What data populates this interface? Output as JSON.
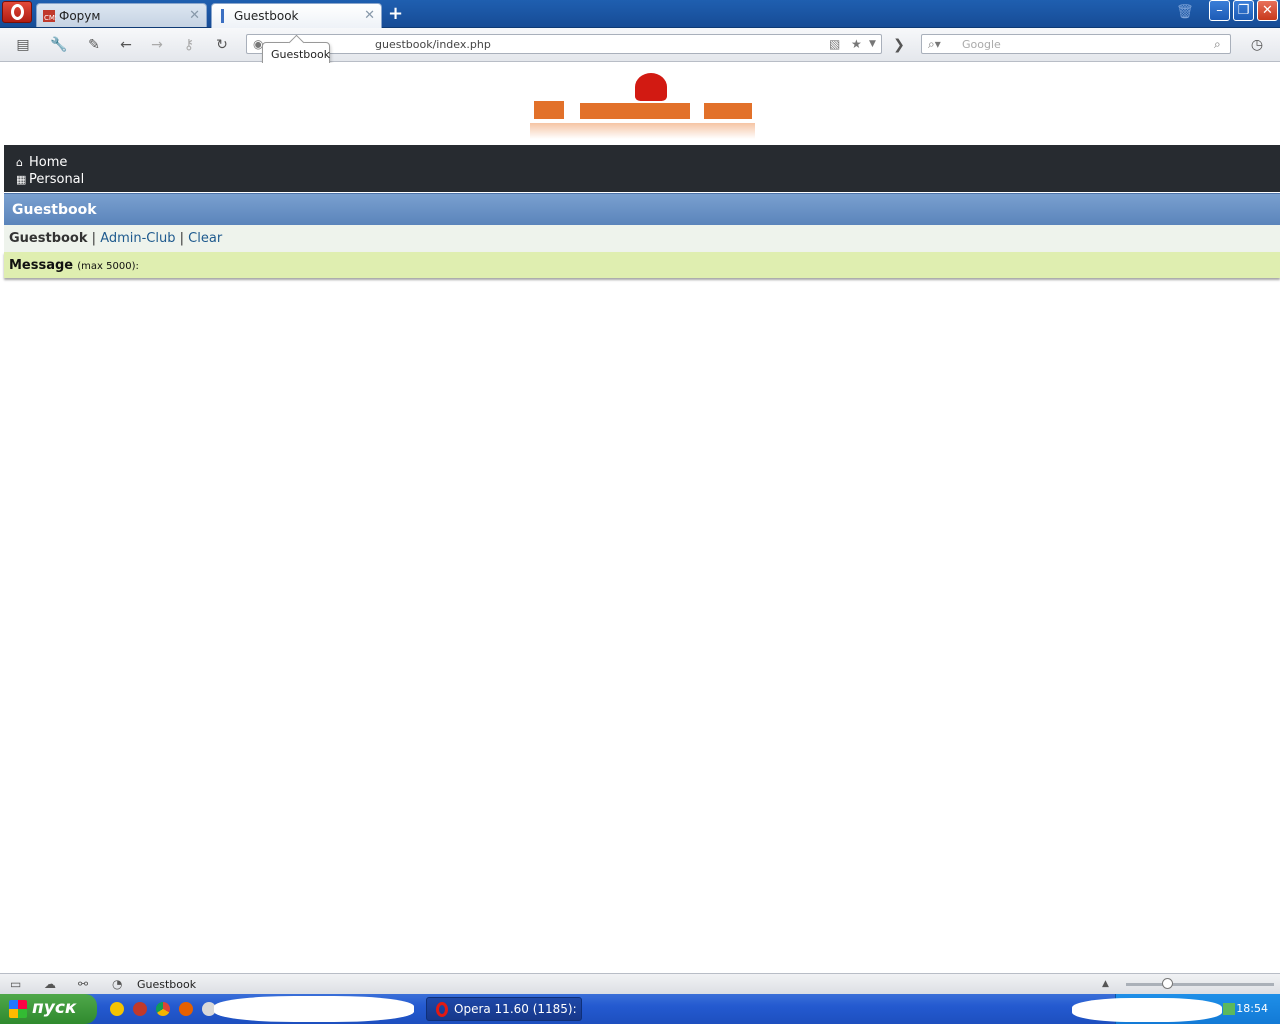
{
  "browser": {
    "tabs": [
      {
        "label": "Форум",
        "active": false
      },
      {
        "label": "Guestbook",
        "active": true
      }
    ],
    "tooltip": "Guestbook",
    "address": "guestbook/index.php",
    "search_placeholder": "Google"
  },
  "page": {
    "nav": [
      {
        "label": "Home",
        "icon": "home-icon"
      },
      {
        "label": "Personal",
        "icon": "grid-icon"
      }
    ],
    "header_title": "Guestbook",
    "links": {
      "current": "Guestbook",
      "sep1": "|",
      "admin": "Admin-Club",
      "sep2": "|",
      "clear": "Clear"
    },
    "message_label": "Message",
    "message_hint": "(max 5000):"
  },
  "statusbar": {
    "title": "Guestbook"
  },
  "taskbar": {
    "start_label": "пуск",
    "task_label": "Opera 11.60 (1185): ...",
    "clock": "18:54"
  },
  "colors": {
    "nav_bg": "#272b30",
    "header_bg": "#6890c5",
    "links_bg": "#eef3ec",
    "message_bg": "#dfeeb0",
    "link_color": "#1e5a8e"
  }
}
